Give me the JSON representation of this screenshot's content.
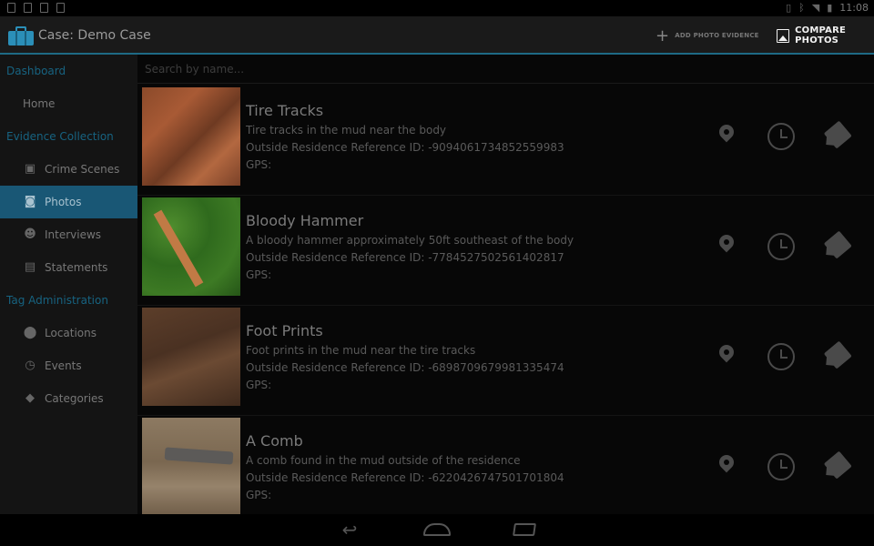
{
  "status_bar": {
    "time": "11:08",
    "left_icons": [
      "notification-icon",
      "storage-icon",
      "image-icon",
      "image-icon"
    ],
    "right_icons": [
      "vibrate-icon",
      "bluetooth-icon",
      "wifi-icon",
      "battery-icon"
    ]
  },
  "action_bar": {
    "title": "Case: Demo Case",
    "add_label": "ADD PHOTO EVIDENCE",
    "compare_label": "COMPARE PHOTOS",
    "accent_color": "#2b8fb8"
  },
  "sidebar": {
    "sections": [
      {
        "header": "Dashboard",
        "items": [
          {
            "label": "Home",
            "icon": ""
          }
        ]
      },
      {
        "header": "Evidence Collection",
        "items": [
          {
            "label": "Crime Scenes",
            "icon": "image-icon"
          },
          {
            "label": "Photos",
            "icon": "camera-icon",
            "active": true
          },
          {
            "label": "Interviews",
            "icon": "people-icon"
          },
          {
            "label": "Statements",
            "icon": "document-icon"
          }
        ]
      },
      {
        "header": "Tag Administration",
        "items": [
          {
            "label": "Locations",
            "icon": "location-pin-icon"
          },
          {
            "label": "Events",
            "icon": "clock-icon"
          },
          {
            "label": "Categories",
            "icon": "tag-icon"
          }
        ]
      }
    ]
  },
  "search": {
    "placeholder": "Search by name..."
  },
  "photos": [
    {
      "title": "Tire Tracks",
      "description": "Tire tracks in the mud near the body",
      "ref_line": "Outside Residence  Reference ID: -9094061734852559983",
      "gps": "GPS:"
    },
    {
      "title": "Bloody Hammer",
      "description": "A bloody hammer approximately 50ft southeast of the body",
      "ref_line": "Outside Residence  Reference ID: -7784527502561402817",
      "gps": "GPS:"
    },
    {
      "title": "Foot Prints",
      "description": "Foot prints in the mud near the tire tracks",
      "ref_line": "Outside Residence  Reference ID: -6898709679981335474",
      "gps": "GPS:"
    },
    {
      "title": "A Comb",
      "description": "A comb found in the mud outside of the residence",
      "ref_line": "Outside Residence  Reference ID: -6220426747501701804",
      "gps": "GPS:"
    }
  ]
}
